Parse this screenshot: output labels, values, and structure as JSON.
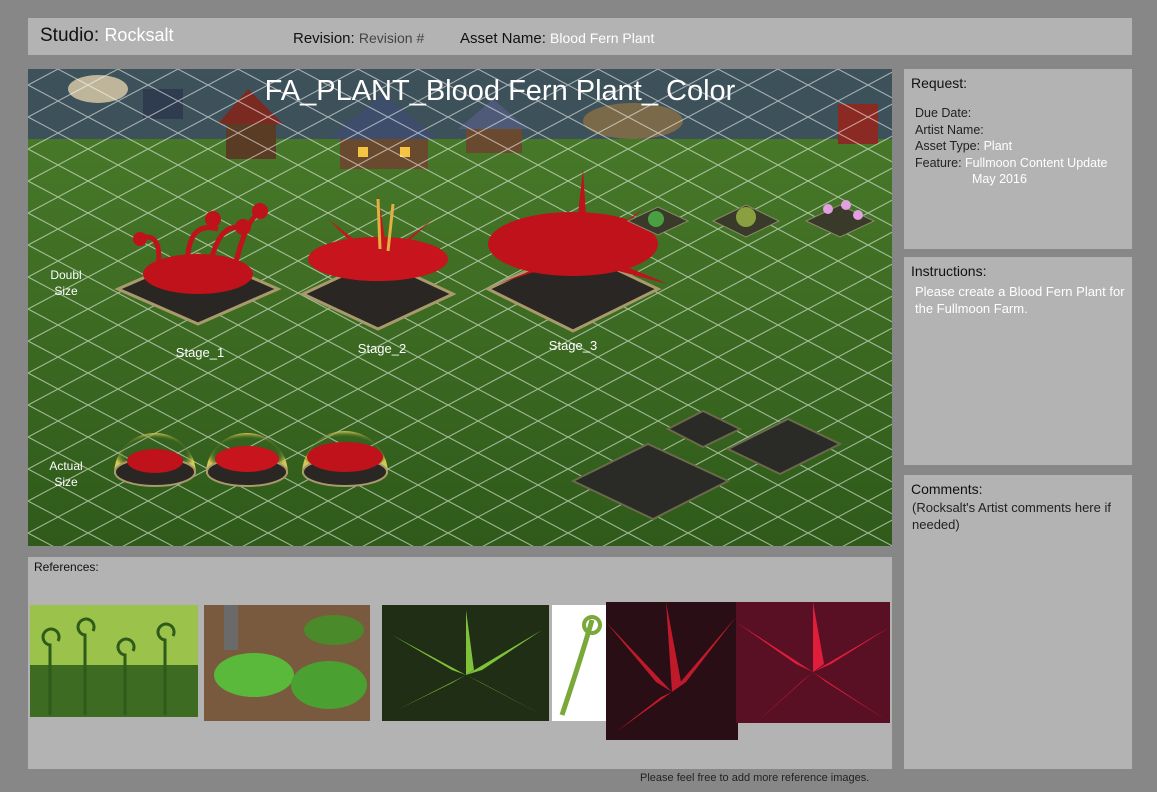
{
  "header": {
    "studio_label": "Studio:",
    "studio_value": "Rocksalt",
    "revision_label": "Revision:",
    "revision_value": "Revision #",
    "asset_label": "Asset Name:",
    "asset_value": "Blood Fern Plant"
  },
  "scene": {
    "title": "FA_PLANT_Blood Fern Plant_ Color",
    "double_size_label_line1": "Doubl",
    "double_size_label_line2": "Size",
    "actual_size_label_line1": "Actual",
    "actual_size_label_line2": "Size",
    "stage_labels": [
      "Stage_1",
      "Stage_2",
      "Stage_3"
    ],
    "colors": {
      "grass": "#3d6b22",
      "fern_red": "#c0121a",
      "soil": "#2a2623",
      "glow": "#e6d25a"
    }
  },
  "references": {
    "title": "References:",
    "footnote": "Please feel free to add more reference images."
  },
  "request": {
    "title": "Request:",
    "due_date_label": "Due Date:",
    "artist_label": "Artist Name:",
    "asset_type_label": "Asset Type:",
    "asset_type_value": "Plant",
    "feature_label": "Feature:",
    "feature_value_line1": "Fullmoon Content Update",
    "feature_value_line2": "May 2016"
  },
  "instructions": {
    "title": "Instructions:",
    "body": "Please create a Blood Fern Plant for the Fullmoon Farm."
  },
  "comments": {
    "title": "Comments:",
    "body": "(Rocksalt's Artist comments here if needed)"
  }
}
